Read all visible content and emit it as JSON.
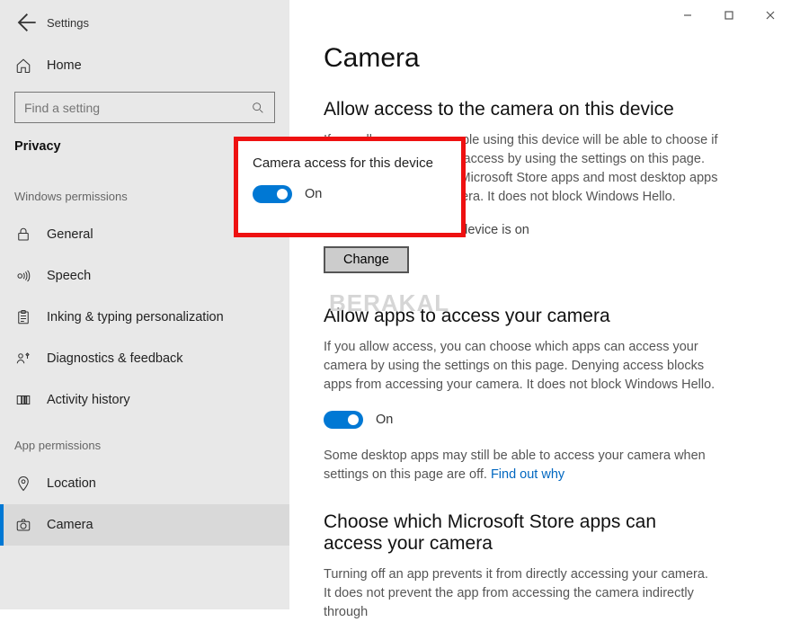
{
  "window": {
    "title": "Settings"
  },
  "sidebar": {
    "home_label": "Home",
    "search_placeholder": "Find a setting",
    "category_label": "Privacy",
    "group_windows": "Windows permissions",
    "group_app": "App permissions",
    "items_win": [
      {
        "label": "General"
      },
      {
        "label": "Speech"
      },
      {
        "label": "Inking & typing personalization"
      },
      {
        "label": "Diagnostics & feedback"
      },
      {
        "label": "Activity history"
      }
    ],
    "items_app": [
      {
        "label": "Location"
      },
      {
        "label": "Camera"
      }
    ]
  },
  "main": {
    "title": "Camera",
    "section1_title": "Allow access to the camera on this device",
    "section1_desc": "If you allow access, people using this device will be able to choose if their apps have camera access by using the settings on this page. Denying access blocks Microsoft Store apps and most desktop apps from accessing the camera. It does not block Windows Hello.",
    "device_status": "Camera access for this device is on",
    "change_btn": "Change",
    "section2_title": "Allow apps to access your camera",
    "section2_desc": "If you allow access, you can choose which apps can access your camera by using the settings on this page. Denying access blocks apps from accessing your camera. It does not block Windows Hello.",
    "toggle2_label": "On",
    "desktop_note_a": "Some desktop apps may still be able to access your camera when settings on this page are off. ",
    "desktop_note_link": "Find out why",
    "section3_title": "Choose which Microsoft Store apps can access your camera",
    "section3_desc": "Turning off an app prevents it from directly accessing your camera. It does not prevent the app from accessing the camera indirectly through"
  },
  "popup": {
    "title": "Camera access for this device",
    "toggle_label": "On"
  },
  "watermark": "BERAKAL"
}
